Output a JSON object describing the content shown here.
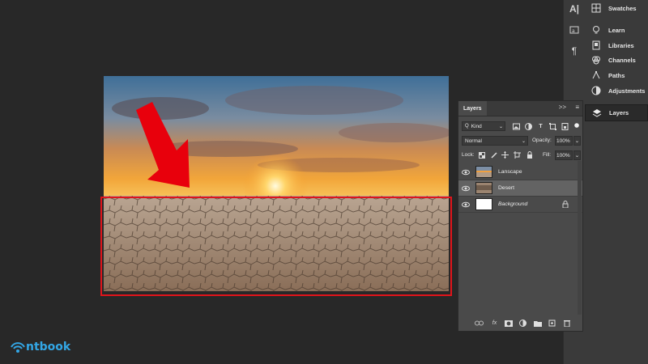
{
  "canvas": {
    "image_alt": "sunset over cracked desert",
    "highlight_color": "#e0141b",
    "arrow_color": "#e8000c"
  },
  "icon_strip": {
    "icons": [
      "character-icon",
      "glyphs-icon",
      "paragraph-icon"
    ],
    "char_glyph": "A|",
    "para_glyph": "¶"
  },
  "panel_list": {
    "items": [
      {
        "label": "Swatches",
        "icon": "swatches-icon"
      },
      {
        "label": "Learn",
        "icon": "lightbulb-icon"
      },
      {
        "label": "Libraries",
        "icon": "libraries-icon"
      },
      {
        "label": "Channels",
        "icon": "channels-icon"
      },
      {
        "label": "Paths",
        "icon": "paths-icon"
      },
      {
        "label": "Adjustments",
        "icon": "adjustments-icon"
      },
      {
        "label": "Layers",
        "icon": "layers-icon"
      }
    ],
    "active": "Layers"
  },
  "layers_panel": {
    "tab_label": "Layers",
    "collapse_glyph": ">>",
    "menu_glyph": "≡",
    "filter": {
      "label": "Kind",
      "glyph": "Q"
    },
    "blend_mode": "Normal",
    "opacity_label": "Opacity:",
    "opacity_value": "100%",
    "lock_label": "Lock:",
    "fill_label": "Fill:",
    "fill_value": "100%",
    "layers": [
      {
        "name": "Lanscape",
        "visible": true,
        "selected": false,
        "italic": false,
        "locked": false
      },
      {
        "name": "Desert",
        "visible": true,
        "selected": true,
        "italic": false,
        "locked": false
      },
      {
        "name": "Background",
        "visible": true,
        "selected": false,
        "italic": true,
        "locked": true
      }
    ],
    "footer_icons": [
      "link-icon",
      "fx-icon",
      "mask-icon",
      "adjustment-layer-icon",
      "folder-icon",
      "new-layer-icon",
      "trash-icon"
    ],
    "fx_glyph": "fx"
  },
  "logo": {
    "text": "ntbook",
    "color": "#33a7e6"
  }
}
